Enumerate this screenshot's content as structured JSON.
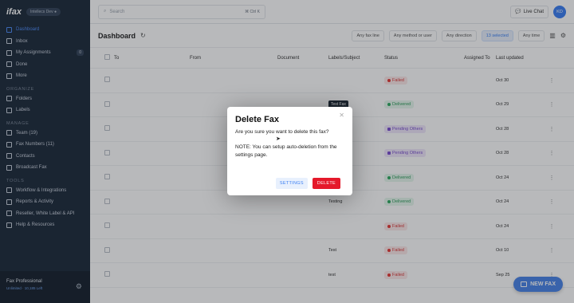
{
  "sidebar": {
    "logo": "ifax",
    "org": "Intellecs Dev ●",
    "items_top": [
      {
        "label": "Dashboard",
        "active": true,
        "icon": "grid-icon"
      },
      {
        "label": "Inbox",
        "icon": "inbox-icon"
      },
      {
        "label": "My Assignments",
        "badge": "0",
        "icon": "user-icon"
      },
      {
        "label": "Done",
        "icon": "check-icon"
      },
      {
        "label": "More",
        "icon": "more-icon"
      }
    ],
    "organize_label": "ORGANIZE",
    "organize_items": [
      {
        "label": "Folders",
        "icon": "folder-icon"
      },
      {
        "label": "Labels",
        "icon": "tag-icon"
      }
    ],
    "manage_label": "MANAGE",
    "manage_items": [
      {
        "label": "Team (19)",
        "icon": "team-icon"
      },
      {
        "label": "Fax Numbers (11)",
        "icon": "hash-icon"
      },
      {
        "label": "Contacts",
        "icon": "contacts-icon"
      },
      {
        "label": "Broadcast Fax",
        "icon": "broadcast-icon"
      }
    ],
    "tools_label": "TOOLS",
    "tools_items": [
      {
        "label": "Workflow & Integrations",
        "icon": "workflow-icon"
      },
      {
        "label": "Reports & Activity",
        "icon": "reports-icon"
      },
      {
        "label": "Reseller, White Label & API",
        "icon": "api-icon"
      },
      {
        "label": "Help & Resources",
        "icon": "help-icon"
      }
    ],
    "plan": {
      "title": "Fax Professional",
      "sub": "Unlimited · 10,185 Left"
    }
  },
  "topbar": {
    "search_placeholder": "Search",
    "search_shortcut": "⌘ Ctrl K",
    "live_chat": "Live Chat",
    "avatar_initials": "KD"
  },
  "toolbar": {
    "title": "Dashboard",
    "filters": [
      "Any fax line",
      "Any method or user",
      "Any direction",
      "13 selected",
      "Any time"
    ]
  },
  "table": {
    "headers": {
      "to": "To",
      "from": "From",
      "document": "Document",
      "labels": "Labels/Subject",
      "status": "Status",
      "assigned": "Assigned To",
      "updated": "Last updated"
    },
    "rows": [
      {
        "label": "",
        "status": "Failed",
        "kind": "failed",
        "date": "Oct 30"
      },
      {
        "label": "Test Fax",
        "status": "Delivered",
        "kind": "delivered",
        "date": "Oct 29"
      },
      {
        "label": "",
        "status": "Pending Others",
        "kind": "pending",
        "date": "Oct 28"
      },
      {
        "label": "",
        "status": "Pending Others",
        "kind": "pending",
        "date": "Oct 28"
      },
      {
        "label": "",
        "status": "Delivered",
        "kind": "delivered",
        "date": "Oct 24"
      },
      {
        "label": "Testing",
        "status": "Delivered",
        "kind": "delivered",
        "date": "Oct 24"
      },
      {
        "label": "",
        "status": "Failed",
        "kind": "failed",
        "date": "Oct 24"
      },
      {
        "label": "Test",
        "status": "Failed",
        "kind": "failed",
        "date": "Oct 10"
      },
      {
        "label": "test",
        "status": "Failed",
        "kind": "failed",
        "date": "Sep 25"
      }
    ]
  },
  "modal": {
    "title": "Delete Fax",
    "message": "Are you sure you want to delete this fax?",
    "note": "NOTE: You can setup auto-deletion from the settings page.",
    "settings_label": "SETTINGS",
    "delete_label": "DELETE"
  },
  "fab": {
    "label": "NEW FAX"
  },
  "colors": {
    "accent": "#3b7ff2",
    "danger": "#e5192a",
    "sidebar": "#1e2b3c"
  }
}
